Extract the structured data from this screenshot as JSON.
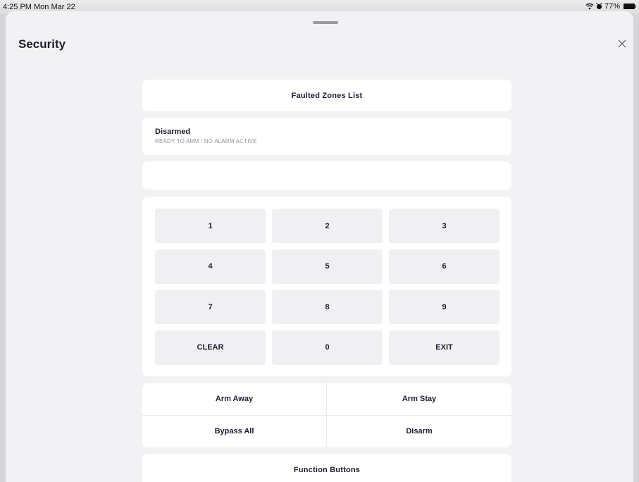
{
  "status_bar": {
    "time": "4:25 PM  Mon Mar 22",
    "battery": "77%"
  },
  "sheet": {
    "title": "Security"
  },
  "faulted_zones": {
    "label": "Faulted Zones List"
  },
  "alarm_status": {
    "title": "Disarmed",
    "subtitle": "READY TO ARM / NO ALARM ACTIVE"
  },
  "code_display": {
    "value": ""
  },
  "keypad": {
    "keys": [
      "1",
      "2",
      "3",
      "4",
      "5",
      "6",
      "7",
      "8",
      "9",
      "CLEAR",
      "0",
      "EXIT"
    ]
  },
  "actions": {
    "arm_away": "Arm Away",
    "arm_stay": "Arm Stay",
    "bypass_all": "Bypass All",
    "disarm": "Disarm"
  },
  "function_buttons": {
    "label": "Function Buttons"
  }
}
